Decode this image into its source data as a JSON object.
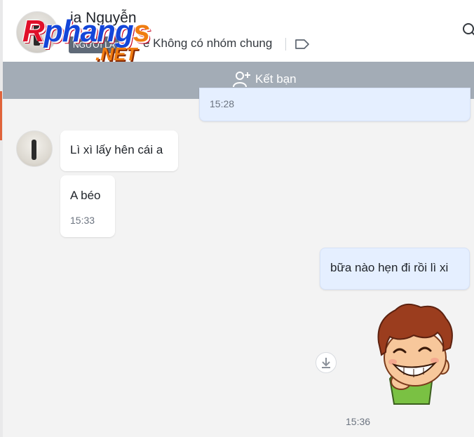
{
  "header": {
    "name": "ia Nguyễn",
    "stranger_badge": "NGƯỜI LẠ",
    "common_groups": "ề Không có nhóm chung",
    "icons": {
      "tag": "tag-icon",
      "search": "search-icon"
    }
  },
  "logo": {
    "word_r": "R",
    "word_p": "phang",
    "word_s": "s",
    "net": ".NET"
  },
  "friend_bar": {
    "label": "Kết bạn",
    "icon": "add-friend-icon"
  },
  "messages": [
    {
      "direction": "outgoing",
      "text": "",
      "time": "15:28"
    },
    {
      "direction": "incoming",
      "text": "Lì xì lấy hên cái a",
      "time": ""
    },
    {
      "direction": "incoming",
      "text": "A béo",
      "time": "15:33"
    },
    {
      "direction": "outgoing",
      "text": "bữa nào hẹn đi rồi lì xi",
      "time": ""
    },
    {
      "direction": "outgoing",
      "type": "sticker",
      "sticker": "grinning-boy-sticker",
      "time": "15:36"
    }
  ],
  "colors": {
    "friend_bar": "#a3acb6",
    "outgoing_bubble": "#e5efff",
    "incoming_bubble": "#ffffff",
    "background": "#f3f3f3",
    "badge": "#5f6a78"
  }
}
